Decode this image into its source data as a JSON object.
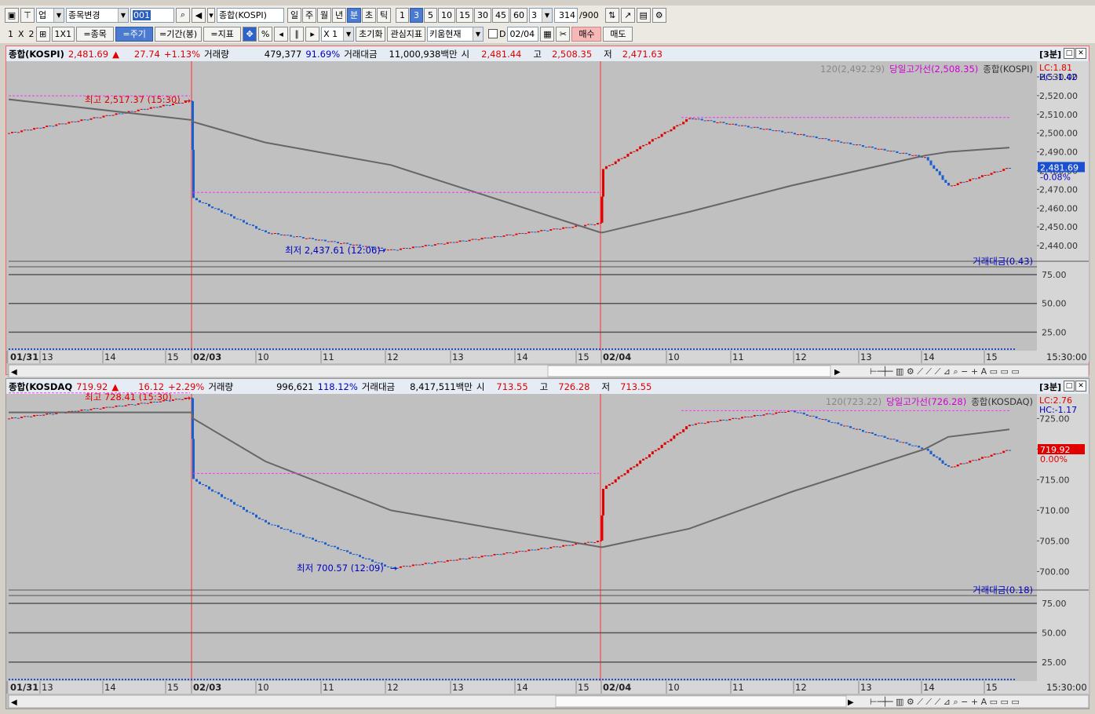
{
  "toolbar1": {
    "market_select": "업",
    "stock_change": "종목변경",
    "code_input": "001",
    "index_select": "종합(KOSPI)",
    "periods": [
      "일",
      "주",
      "월",
      "년",
      "분",
      "초",
      "틱"
    ],
    "active_period": "분",
    "minutes": [
      "1",
      "3",
      "5",
      "10",
      "15",
      "30",
      "45",
      "60"
    ],
    "active_minute": "3",
    "interval_value": "3",
    "count_value": "314",
    "count_max": "/900"
  },
  "toolbar2": {
    "layout_labels": [
      "1",
      "X",
      "2"
    ],
    "layout_1x1": "1X1",
    "items": [
      "=종목",
      "=주기",
      "=기간(봉)",
      "=지표"
    ],
    "percent": "%",
    "zoom": "X 1",
    "reset": "초기화",
    "watch": "관심지표",
    "kiwoom": "키움현재",
    "d_label": "D",
    "date": "02/04",
    "buy": "매수",
    "sell": "매도"
  },
  "panels": [
    {
      "name": "종합(KOSPI)",
      "price": "2,481.69",
      "change": "27.74",
      "change_pct": "+1.13%",
      "vol_label": "거래량",
      "volume": "479,377",
      "vol_pct": "91.69%",
      "amt_label": "거래대금",
      "amount": "11,000,938백만",
      "open_label": "시",
      "open": "2,481.44",
      "high_label": "고",
      "high": "2,508.35",
      "low_label": "저",
      "low": "2,471.63",
      "period_tag": "[3분]",
      "legend_ma": "120(2,492.29)",
      "legend_high": "당일고가선(2,508.35)",
      "legend_name": "종합(KOSPI)",
      "lc": "LC:1.81",
      "hc": "HC:-1.42",
      "cur_price": "2,481.69",
      "cur_pct": "-0.08%",
      "max_label": "최고 2,517.37 (15:30)",
      "min_label": "최저 2,437.61 (12:06)",
      "y_ticks": [
        "2,530.00",
        "2,520.00",
        "2,510.00",
        "2,500.00",
        "2,490.00",
        "2,480.00",
        "2,470.00",
        "2,460.00",
        "2,450.00",
        "2,440.00"
      ],
      "sub_label": "거래대금(0.43)",
      "sub_ticks": [
        "75.00",
        "50.00",
        "25.00"
      ],
      "x_labels": [
        "01/31",
        "13",
        "14",
        "15",
        "02/03",
        "10",
        "11",
        "12",
        "13",
        "14",
        "15",
        "02/04",
        "10",
        "11",
        "12",
        "13",
        "14",
        "15"
      ],
      "time": "15:30:00"
    },
    {
      "name": "종합(KOSDAQ",
      "price": "719.92",
      "change": "16.12",
      "change_pct": "+2.29%",
      "vol_label": "거래량",
      "volume": "996,621",
      "vol_pct": "118.12%",
      "amt_label": "거래대금",
      "amount": "8,417,511백만",
      "open_label": "시",
      "open": "713.55",
      "high_label": "고",
      "high": "726.28",
      "low_label": "저",
      "low": "713.55",
      "period_tag": "[3분]",
      "legend_ma": "120(723.22)",
      "legend_high": "당일고가선(726.28)",
      "legend_name": "종합(KOSDAQ)",
      "lc": "LC:2.76",
      "hc": "HC:-1.17",
      "cur_price": "719.92",
      "cur_pct": "0.00%",
      "max_label": "최고 728.41 (15:30)",
      "min_label": "최저 700.57 (12:09)",
      "y_ticks": [
        "725.00",
        "720.00",
        "715.00",
        "710.00",
        "705.00",
        "700.00"
      ],
      "sub_label": "거래대금(0.18)",
      "sub_ticks": [
        "75.00",
        "50.00",
        "25.00"
      ],
      "x_labels": [
        "01/31",
        "13",
        "14",
        "15",
        "02/03",
        "10",
        "11",
        "12",
        "13",
        "14",
        "15",
        "02/04",
        "10",
        "11",
        "12",
        "13",
        "14",
        "15"
      ],
      "time": "15:30:00"
    }
  ],
  "chart_data": [
    {
      "type": "line",
      "title": "종합(KOSPI)",
      "x": [
        "01/31 13:00",
        "01/31 15:30",
        "02/03 09:00",
        "02/03 10:00",
        "02/03 12:06",
        "02/03 15:30",
        "02/04 09:00",
        "02/04 10:30",
        "02/04 12:00",
        "02/04 14:00",
        "02/04 14:30",
        "02/04 15:30"
      ],
      "series": [
        {
          "name": "종합(KOSPI)",
          "values": [
            2500,
            2517.37,
            2465,
            2447,
            2437.61,
            2452,
            2481,
            2508,
            2500,
            2487,
            2471.63,
            2481.69
          ]
        },
        {
          "name": "120",
          "values": [
            2518,
            2507,
            2506,
            2495,
            2483,
            2447,
            2447,
            2458,
            2472,
            2488,
            2490,
            2492.29
          ]
        }
      ],
      "ylim": [
        2435,
        2535
      ]
    },
    {
      "type": "line",
      "title": "종합(KOSDAQ)",
      "x": [
        "01/31 13:00",
        "01/31 15:30",
        "02/03 09:00",
        "02/03 10:00",
        "02/03 12:09",
        "02/03 15:30",
        "02/04 09:00",
        "02/04 10:30",
        "02/04 12:00",
        "02/04 14:00",
        "02/04 14:30",
        "02/04 15:30"
      ],
      "series": [
        {
          "name": "종합(KOSDAQ)",
          "values": [
            725,
            728.41,
            715,
            708,
            700.57,
            705,
            713.55,
            724,
            726.28,
            720,
            717,
            719.92
          ]
        },
        {
          "name": "120",
          "values": [
            726,
            726,
            725,
            718,
            710,
            704,
            704,
            707,
            713,
            720,
            722,
            723.22
          ]
        }
      ],
      "ylim": [
        698,
        728
      ]
    }
  ]
}
